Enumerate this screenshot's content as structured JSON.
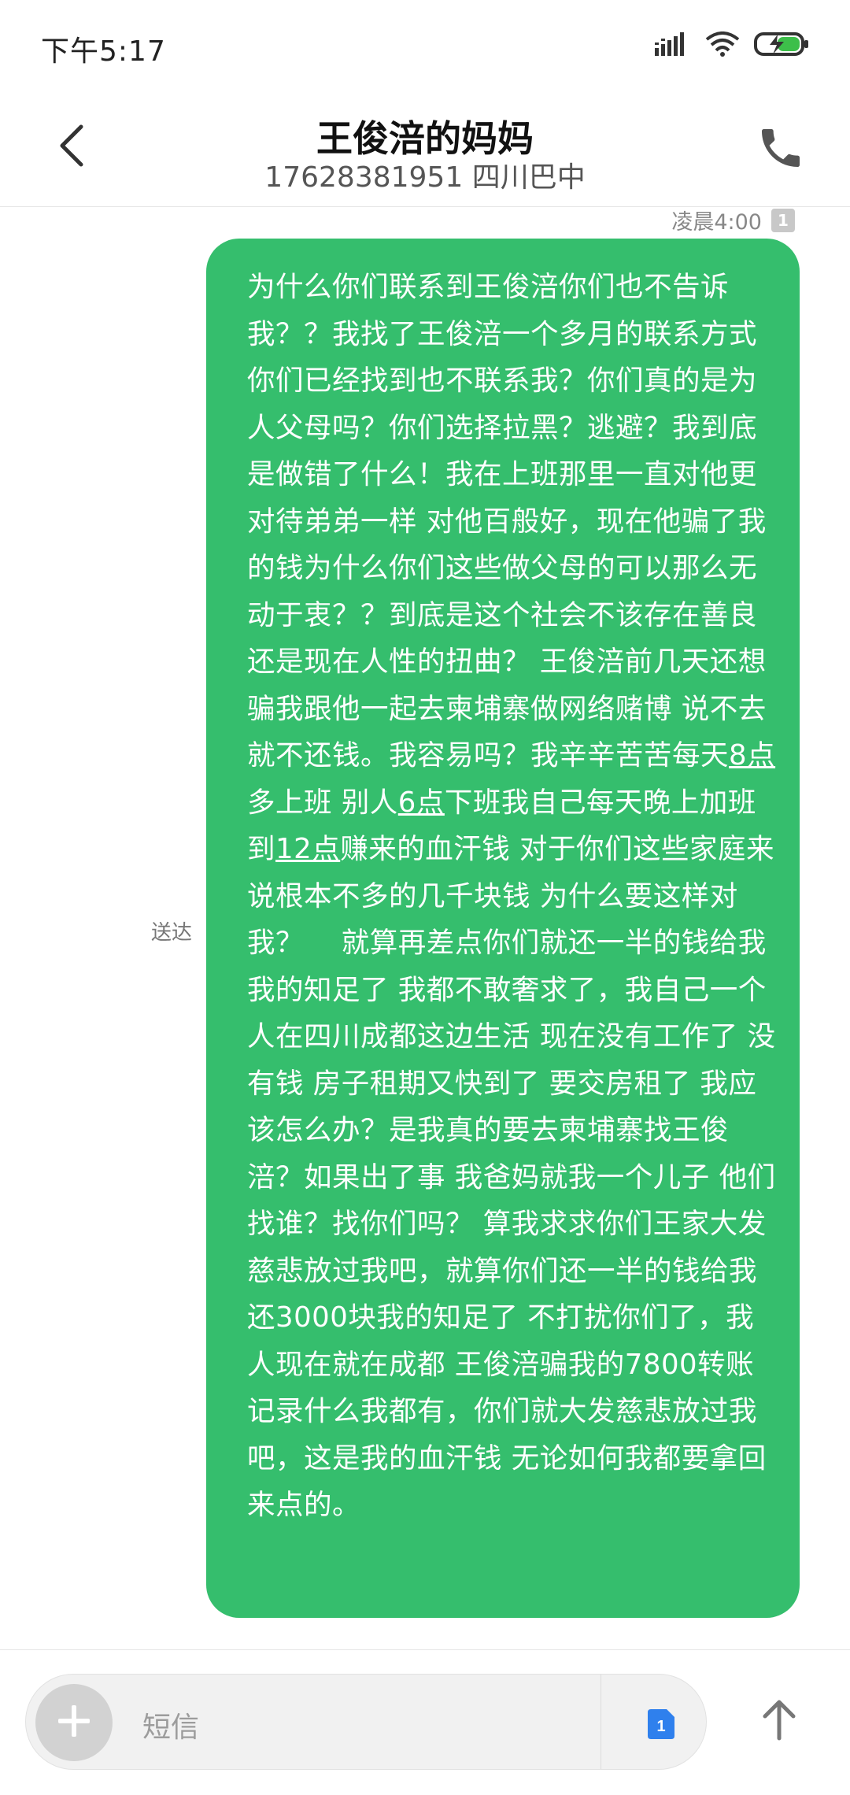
{
  "status_bar": {
    "time": "下午5:17",
    "icons": [
      "signal-icon",
      "wifi-icon",
      "battery-charging-icon"
    ]
  },
  "header": {
    "contact_name": "王俊涪的妈妈",
    "contact_subtitle": "17628381951 四川巴中",
    "back_icon": "chevron-left-icon",
    "call_icon": "phone-icon"
  },
  "conversation": {
    "messages": [
      {
        "direction": "outgoing",
        "timestamp": "凌晨4:00",
        "sim_slot": "1",
        "status": "送达",
        "text_parts": [
          "为什么你们联系到王俊涪你们也不告诉我？？我找了王俊涪一个多月的联系方式 你们已经找到也不联系我？你们真的是为人父母吗？你们选择拉黑？逃避？我到底是做错了什么！我在上班那里一直对他更对待弟弟一样 对他百般好，现在他骗了我的钱为什么你们这些做父母的可以那么无动于衷？？到底是这个社会不该存在善良还是现在人性的扭曲？ 王俊涪前几天还想骗我跟他一起去柬埔寨做网络赌博 说不去就不还钱。我容易吗？我辛辛苦苦每天",
          "8点",
          "多上班 别人",
          "6点",
          "下班我自己每天晚上加班到",
          "12点",
          "赚来的血汗钱 对于你们这些家庭来说根本不多的几千块钱 为什么要这样对我？　 就算再差点你们就还一半的钱给我 我的知足了 我都不敢奢求了，我自己一个人在四川成都这边生活 现在没有工作了 没有钱 房子租期又快到了 要交房租了 我应该怎么办？是我真的要去柬埔寨找王俊涪？如果出了事 我爸妈就我一个儿子 他们找谁？找你们吗？ 算我求求你们王家大发慈悲放过我吧，就算你们还一半的钱给我 还3000块我的知足了 不打扰你们了，我人现在就在成都 王俊涪骗我的7800转账记录什么我都有，你们就大发慈悲放过我吧，这是我的血汗钱 无论如何我都要拿回来点的。"
        ]
      }
    ]
  },
  "input_bar": {
    "placeholder": "短信",
    "sim_selected": "1",
    "add_icon": "plus-icon",
    "send_icon": "arrow-up-icon"
  },
  "colors": {
    "bubble": "#35be6d",
    "sim_blue": "#2f80ed",
    "battery_green": "#3dbf4a"
  }
}
